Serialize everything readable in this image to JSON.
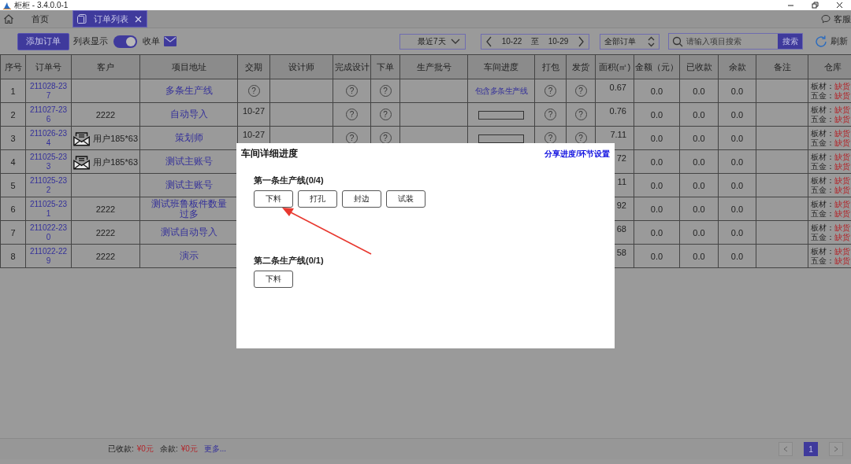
{
  "window": {
    "title": "柜柜 - 3.4.0.0-1"
  },
  "tabs": [
    {
      "label": "首页",
      "selected": false,
      "kind": "home",
      "closable": false
    },
    {
      "label": "订单列表",
      "selected": true,
      "kind": "document",
      "closable": true
    }
  ],
  "support": {
    "label": "客服"
  },
  "toolbar": {
    "add_button": "添加订单",
    "list_view": {
      "label": "列表显示",
      "on": true
    },
    "inbox": "收单",
    "date_filter": "最近7天",
    "date_from": "10-22",
    "date_sep": "至",
    "date_to": "10-29",
    "order_filter": "全部订单",
    "search": {
      "placeholder": "请输入项目搜索",
      "button": "搜索"
    },
    "refresh": "刷新"
  },
  "table": {
    "columns": [
      "序号",
      "订单号",
      "客户",
      "项目地址",
      "交期",
      "设计师",
      "完成设计",
      "下单",
      "生产批号",
      "车间进度",
      "打包",
      "发货",
      "面积(㎡)",
      "金额（元）",
      "已收款",
      "余款",
      "备注",
      "仓库"
    ],
    "rows": [
      {
        "no": "1",
        "order": "211028-237",
        "address": "多条生产线",
        "due": {
          "kind": "help",
          "text": "?"
        },
        "design_done": {
          "kind": "help",
          "text": "?"
        },
        "ordered": {
          "kind": "help",
          "text": "?"
        },
        "progress": {
          "kind": "link",
          "text": "包含多条生产线"
        },
        "pack": {
          "kind": "help",
          "text": "?"
        },
        "ship": {
          "kind": "help",
          "text": "?"
        },
        "area": "0.67",
        "amount": "0.0",
        "received": "0.0",
        "balance": "0.0",
        "stock": {
          "kind": "stock",
          "lines": [
            {
              "label": "板材：",
              "status": "缺货"
            },
            {
              "label": "五金：",
              "status": "缺货"
            }
          ]
        }
      },
      {
        "no": "2",
        "order": "211027-236",
        "customer": "2222",
        "address": "自动导入",
        "due": "10-27",
        "design_done": {
          "kind": "help",
          "text": "?"
        },
        "ordered": {
          "kind": "help",
          "text": "?"
        },
        "progress": {
          "kind": "bar",
          "level": 0
        },
        "pack": {
          "kind": "help",
          "text": "?"
        },
        "ship": {
          "kind": "help",
          "text": "?"
        },
        "area": "0.76",
        "amount": "0.0",
        "received": "0.0",
        "balance": "0.0",
        "stock": {
          "kind": "stock",
          "lines": [
            {
              "label": "板材：",
              "status": "缺货"
            },
            {
              "label": "五金：",
              "status": "缺货"
            }
          ]
        }
      },
      {
        "no": "3",
        "order": "211026-234",
        "customer": {
          "kind": "contact",
          "text": "用户185*63"
        },
        "address": "策划师",
        "due": "10-27",
        "design_done": {
          "kind": "help",
          "text": "?"
        },
        "ordered": {
          "kind": "help",
          "text": "?"
        },
        "progress": {
          "kind": "bar",
          "level": 0
        },
        "pack": {
          "kind": "help",
          "text": "?"
        },
        "ship": {
          "kind": "help",
          "text": "?"
        },
        "area": "7.11",
        "amount": "0.0",
        "received": "0.0",
        "balance": "0.0",
        "stock": {
          "kind": "stock",
          "lines": [
            {
              "label": "板材：",
              "status": "缺货"
            },
            {
              "label": "五金：",
              "status": "缺货"
            }
          ]
        }
      },
      {
        "no": "4",
        "order": "211025-233",
        "customer": {
          "kind": "contact",
          "text": "用户185*63"
        },
        "address": "测试主账号",
        "area": "72",
        "amount": "0.0",
        "received": "0.0",
        "balance": "0.0",
        "stock": {
          "kind": "stock",
          "lines": [
            {
              "label": "板材：",
              "status": "缺货"
            },
            {
              "label": "五金：",
              "status": "缺货"
            }
          ]
        }
      },
      {
        "no": "5",
        "order": "211025-232",
        "address": "测试主账号",
        "area": "11",
        "amount": "0.0",
        "received": "0.0",
        "balance": "0.0",
        "stock": {
          "kind": "stock",
          "lines": [
            {
              "label": "板材：",
              "status": "缺货"
            },
            {
              "label": "五金：",
              "status": "缺货"
            }
          ]
        }
      },
      {
        "no": "6",
        "order": "211025-231",
        "customer": "2222",
        "address": "测试班鲁板件数量过多",
        "area": "92",
        "amount": "0.0",
        "received": "0.0",
        "balance": "0.0",
        "stock": {
          "kind": "stock",
          "lines": [
            {
              "label": "板材：",
              "status": "缺货"
            },
            {
              "label": "五金：",
              "status": "缺货"
            }
          ]
        }
      },
      {
        "no": "7",
        "order": "211022-230",
        "customer": "2222",
        "address": "测试自动导入",
        "area": "68",
        "amount": "0.0",
        "received": "0.0",
        "balance": "0.0",
        "stock": {
          "kind": "stock",
          "lines": [
            {
              "label": "板材：",
              "status": "缺货"
            },
            {
              "label": "五金：",
              "status": "缺货"
            }
          ]
        }
      },
      {
        "no": "8",
        "order": "211022-229",
        "customer": "2222",
        "address": "演示",
        "area": "58",
        "amount": "0.0",
        "received": "0.0",
        "balance": "0.0",
        "stock": {
          "kind": "stock",
          "lines": [
            {
              "label": "板材：",
              "status": "缺货"
            },
            {
              "label": "五金：",
              "status": "缺货"
            }
          ]
        }
      }
    ]
  },
  "modal": {
    "title": "车间详细进度",
    "link": "分享进度/环节设置",
    "lines": [
      {
        "name": "第一条生产线(0/4)",
        "steps": [
          "下料",
          "打孔",
          "封边",
          "试装"
        ]
      },
      {
        "name": "第二条生产线(0/1)",
        "steps": [
          "下料"
        ]
      }
    ]
  },
  "footer": {
    "totals": [
      {
        "label": "已收款:",
        "value": "¥0元"
      },
      {
        "label": "余款:",
        "value": "¥0元"
      }
    ],
    "more": "更多...",
    "pages": [
      {
        "label": "1",
        "selected": true
      }
    ]
  }
}
